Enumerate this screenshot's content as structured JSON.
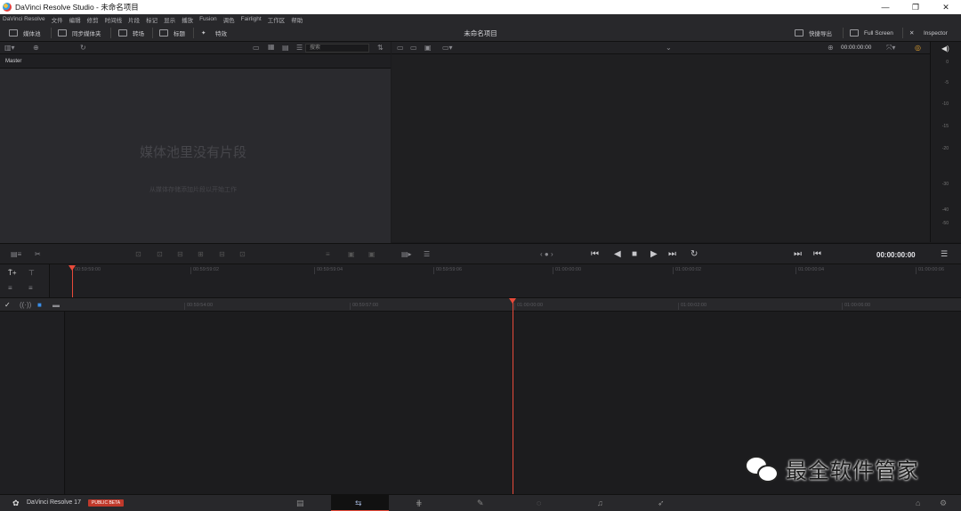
{
  "window": {
    "title": "DaVinci Resolve Studio - 未命名项目",
    "controls": [
      "—",
      "❐",
      "✕"
    ]
  },
  "menu": [
    "DaVinci Resolve",
    "文件",
    "编辑",
    "修剪",
    "时间线",
    "片段",
    "标记",
    "显示",
    "播放",
    "Fusion",
    "调色",
    "Fairlight",
    "工作区",
    "帮助"
  ],
  "toolbar": {
    "media_pool": "媒体池",
    "sync_bin": "同步媒体夹",
    "transitions": "转场",
    "titles": "标题",
    "effects": "特效",
    "project_title": "未命名项目",
    "quick_export": "快捷导出",
    "full_screen": "Full Screen",
    "inspector": "Inspector"
  },
  "media_pool": {
    "search_placeholder": "搜索",
    "bin_name": "Master",
    "empty_title": "媒体池里没有片段",
    "empty_subtitle": "从媒体存储添加片段以开始工作"
  },
  "viewer": {
    "timecode_top": "00:00:00:00",
    "timecode": "00:00:00:00"
  },
  "audio_meter": {
    "labels": [
      "0",
      "-5",
      "-10",
      "-15",
      "-20",
      "-30",
      "-40",
      "-50"
    ]
  },
  "timeline": {
    "upper_ticks": [
      "00:59:59:00",
      "00:59:59:02",
      "00:59:59:04",
      "00:59:59:06",
      "01:00:00:00",
      "01:00:00:02",
      "01:00:00:04",
      "01:00:00:06"
    ],
    "lower_ticks": [
      "00:59:54:00",
      "00:59:57:00",
      "01:00:00:00",
      "01:00:02:00",
      "01:00:06:00"
    ]
  },
  "footer": {
    "app_name": "DaVinci Resolve 17",
    "beta_badge": "PUBLIC BETA"
  },
  "watermark": {
    "text": "最全软件管家"
  },
  "colors": {
    "playhead": "#e84a3a",
    "badge": "#c0392b"
  }
}
